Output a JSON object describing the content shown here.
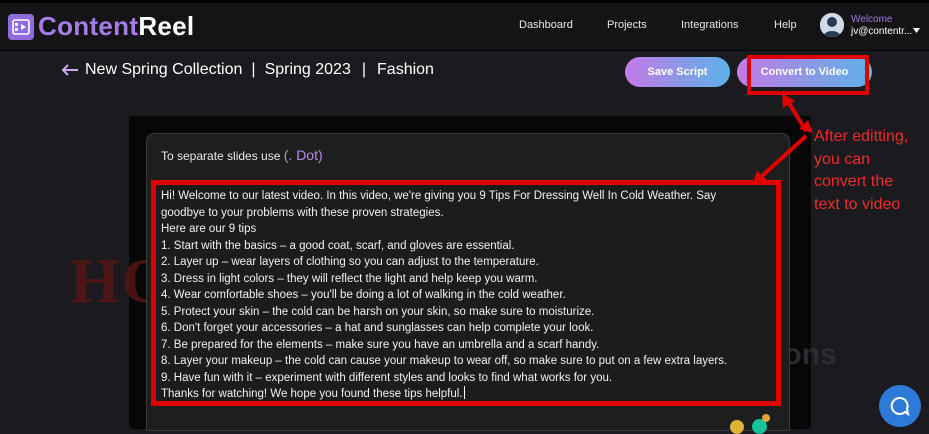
{
  "app": {
    "logo": {
      "part1": "Content",
      "part2": "Reel",
      "icon": "film-strip-logo-icon"
    },
    "nav": [
      {
        "label": "Dashboard"
      },
      {
        "label": "Projects"
      },
      {
        "label": "Integrations"
      },
      {
        "label": "Help"
      }
    ],
    "user": {
      "welcome": "Welcome",
      "email": "jv@contentr...",
      "avatar_icon": "user-avatar-icon"
    }
  },
  "page": {
    "breadcrumb": [
      "New Spring Collection",
      "|",
      "Spring 2023",
      "|",
      "Fashion"
    ],
    "back_icon": "arrow-left-icon",
    "save_label": "Save Script",
    "convert_label": "Convert to Video"
  },
  "editor": {
    "hint_prefix": "To separate slides use ",
    "hint_dot": "(. Dot)",
    "lines": [
      "Hi! Welcome to our latest video. In this video, we're giving you 9 Tips For Dressing Well In Cold Weather. Say",
      "goodbye to your problems with these proven strategies.",
      "Here are our 9 tips",
      "1. Start with the basics – a good coat, scarf, and gloves are essential.",
      "2. Layer up – wear layers of clothing so you can adjust to the temperature.",
      "3. Dress in light colors – they will reflect the light and help keep you warm.",
      "4. Wear comfortable shoes – you'll be doing a lot of walking in the cold weather.",
      "5. Protect your skin – the cold can be harsh on your skin, so make sure to moisturize.",
      "6. Don't forget your accessories – a hat and sunglasses can help complete your look.",
      "7. Be prepared for the elements – make sure you have an umbrella and a scarf handy.",
      "8. Layer your makeup – the cold can cause your makeup to wear off, so make sure to put on a few extra layers.",
      "9. Have fun with it – experiment with different styles and looks to find what works for you.",
      "Thanks for watching! We hope you found these tips helpful."
    ]
  },
  "annotation": {
    "lines": [
      "After editting,",
      "you can",
      "convert the",
      "text to video"
    ],
    "color": "#ee2b2b"
  },
  "watermark": {
    "left": "HO",
    "right": "Decisions"
  },
  "colors": {
    "accent_purple": "#a67be6",
    "highlight_red": "#e00000",
    "chat_blue": "#2d7ad8"
  }
}
